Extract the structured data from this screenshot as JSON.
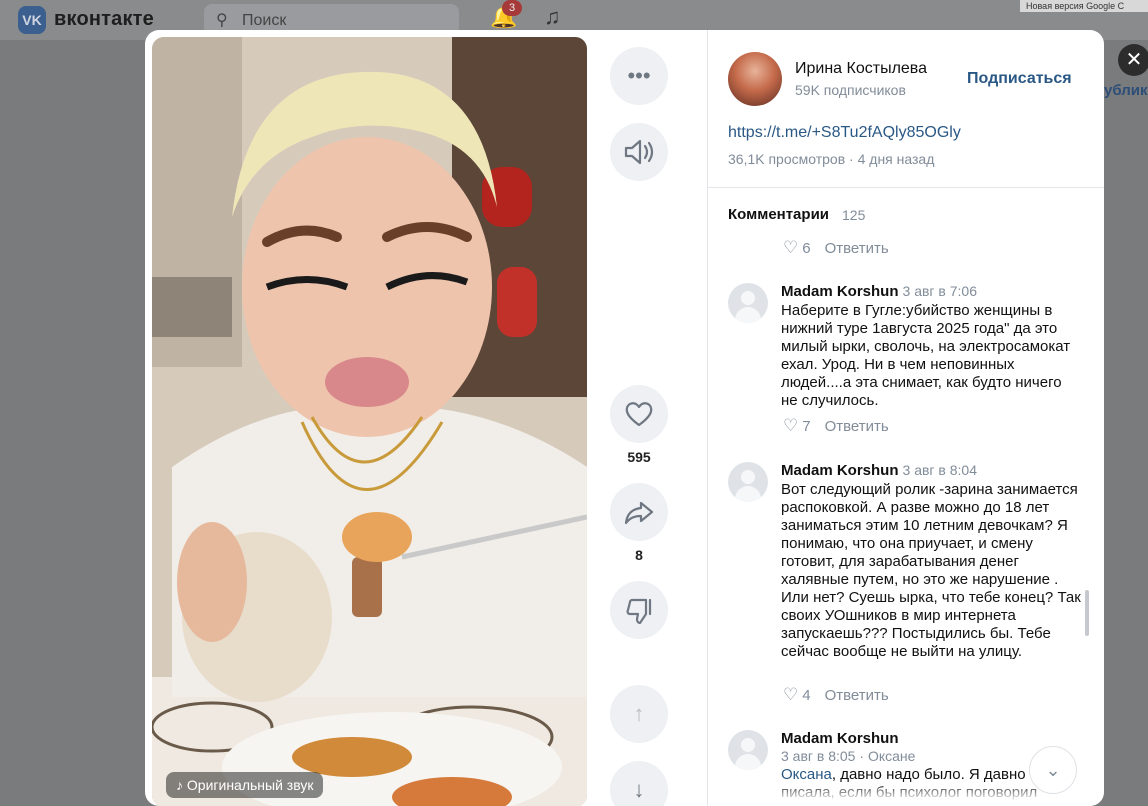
{
  "header": {
    "logo_text": "VK",
    "brand": "вконтакте",
    "search_placeholder": "Поиск",
    "notifications_count": "3",
    "browser_note": "Новая версия Google C",
    "bg_public_fragment": "ублик"
  },
  "video": {
    "sound_label": "♪ Оригинальный звук"
  },
  "actions": {
    "likes": "595",
    "shares": "8"
  },
  "author": {
    "name": "Ирина Костылева",
    "subscribers": "59K подписчиков",
    "subscribe_label": "Подписаться",
    "link": "https://t.me/+S8Tu2fAQly85OGly",
    "meta": "36,1K просмотров · 4 дня назад"
  },
  "comments": {
    "title": "Комментарии",
    "count": "125",
    "reply_label": "Ответить",
    "top_likes": "6",
    "items": [
      {
        "author": "Madam Korshun",
        "date": "3 авг в 7:06",
        "text": "Наберите в Гугле:убийство женщины в нижний туре 1августа 2025 года\" да это милый ырки, сволочь, на электросамокат ехал. Урод. Ни в чем неповинных людей....а эта снимает, как будто ничего не случилось.",
        "likes": "7"
      },
      {
        "author": "Madam Korshun",
        "date": "3 авг в 8:04",
        "text": "Вот следующий ролик -зарина занимается распоковкой. А разве можно до 18 лет заниматься этим 10 летним девочкам? Я понимаю, что она приучает, и смену готовит, для зарабатывания денег халявные путем, но это же нарушение . Или нет? Суешь ырка, что тебе конец? Так своих УОшников в мир интернета запускаешь??? Постыдились бы. Тебе сейчас вообще не выйти на улицу.",
        "likes": "4"
      },
      {
        "author": "Madam Korshun",
        "date": "3 авг в 8:05",
        "reply_to": "Оксане",
        "mention": "Оксана",
        "text": ", давно надо было. Я давно писала, если бы психолог поговорил"
      }
    ]
  },
  "icons": {
    "more": "more-dots-icon",
    "volume": "volume-icon",
    "like": "heart-icon",
    "share": "share-icon",
    "dislike": "thumbs-down-icon",
    "prev": "arrow-up-icon",
    "next": "arrow-down-icon",
    "close": "close-icon"
  }
}
